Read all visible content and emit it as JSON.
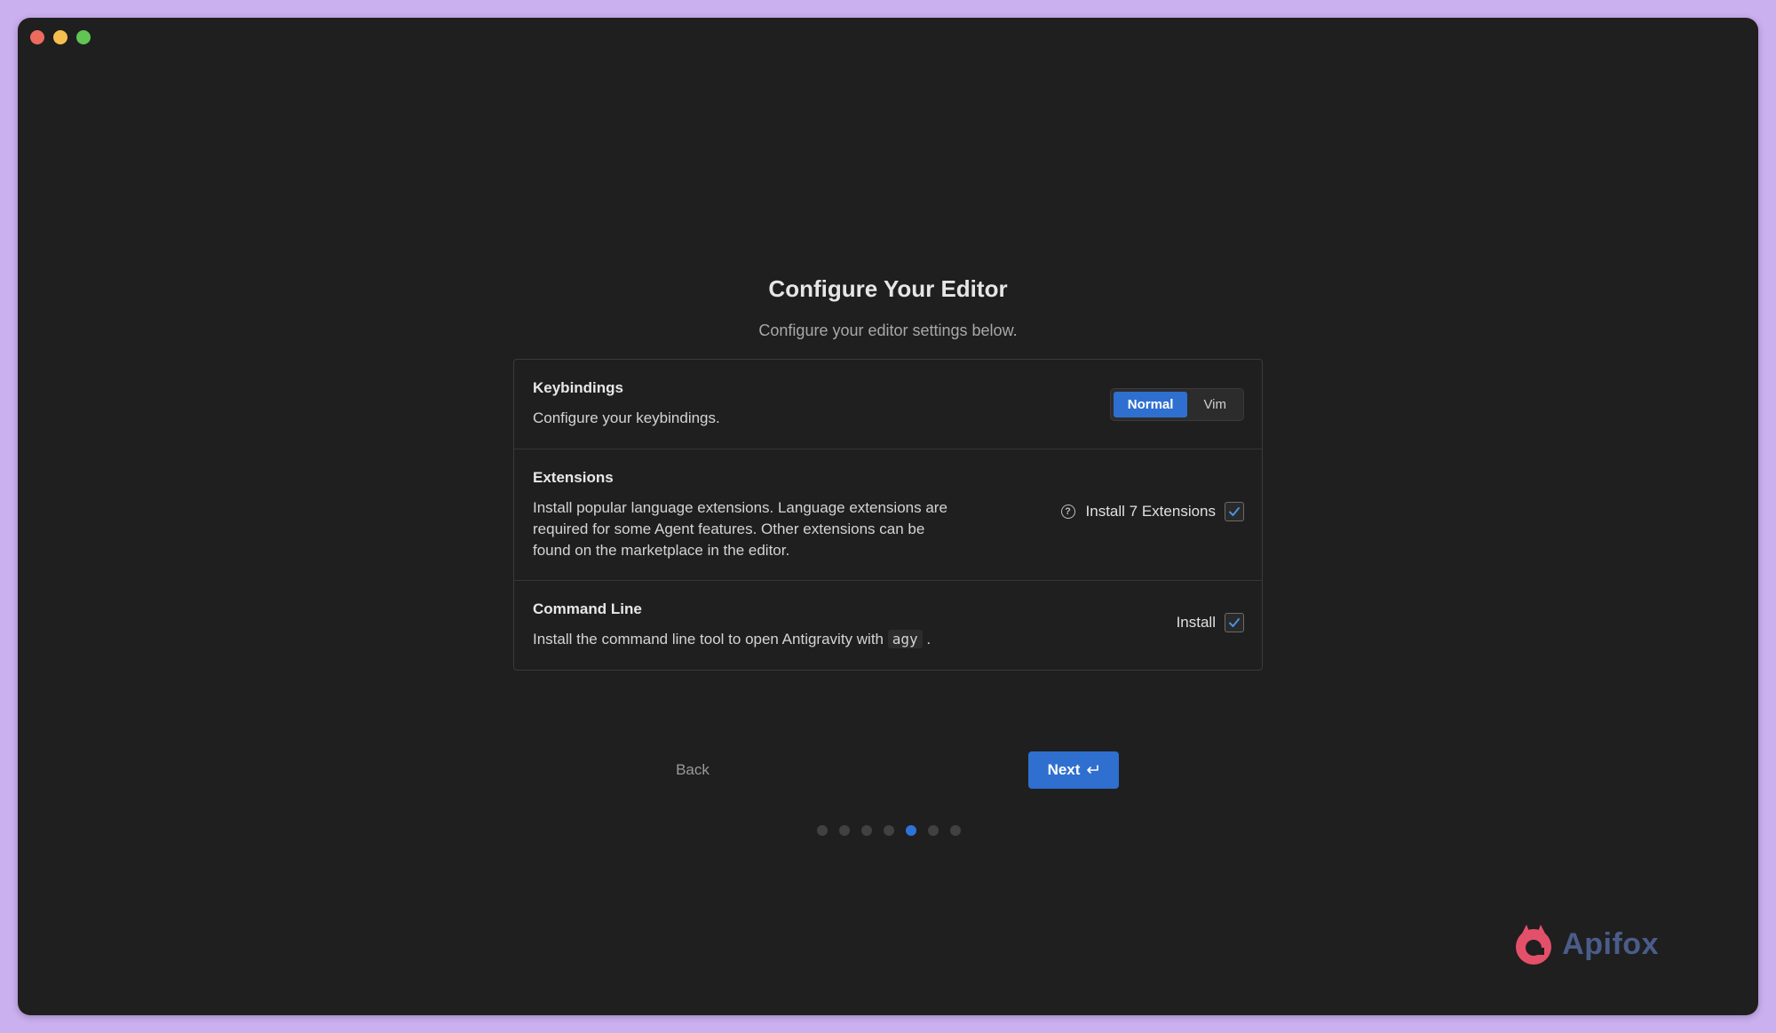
{
  "window": {
    "traffic_lights": [
      "close",
      "minimize",
      "maximize"
    ]
  },
  "header": {
    "title": "Configure Your Editor",
    "subtitle": "Configure your editor settings below."
  },
  "settings": {
    "keybindings": {
      "title": "Keybindings",
      "description": "Configure your keybindings.",
      "options": [
        "Normal",
        "Vim"
      ],
      "selected": "Normal"
    },
    "extensions": {
      "title": "Extensions",
      "description": "Install popular language extensions. Language extensions are required for some Agent features. Other extensions can be found on the marketplace in the editor.",
      "control_label": "Install 7 Extensions",
      "checked": true
    },
    "command_line": {
      "title": "Command Line",
      "description_prefix": "Install the command line tool to open Antigravity with",
      "code": "agy",
      "description_suffix": ".",
      "control_label": "Install",
      "checked": true
    }
  },
  "footer": {
    "back_label": "Back",
    "next_label": "Next",
    "steps_total": 7,
    "current_step": 5
  },
  "watermark": {
    "brand": "Apifox"
  },
  "colors": {
    "accent": "#2f6fcf",
    "window_bg": "#1f1f1f",
    "page_bg": "#cbb0f0"
  }
}
